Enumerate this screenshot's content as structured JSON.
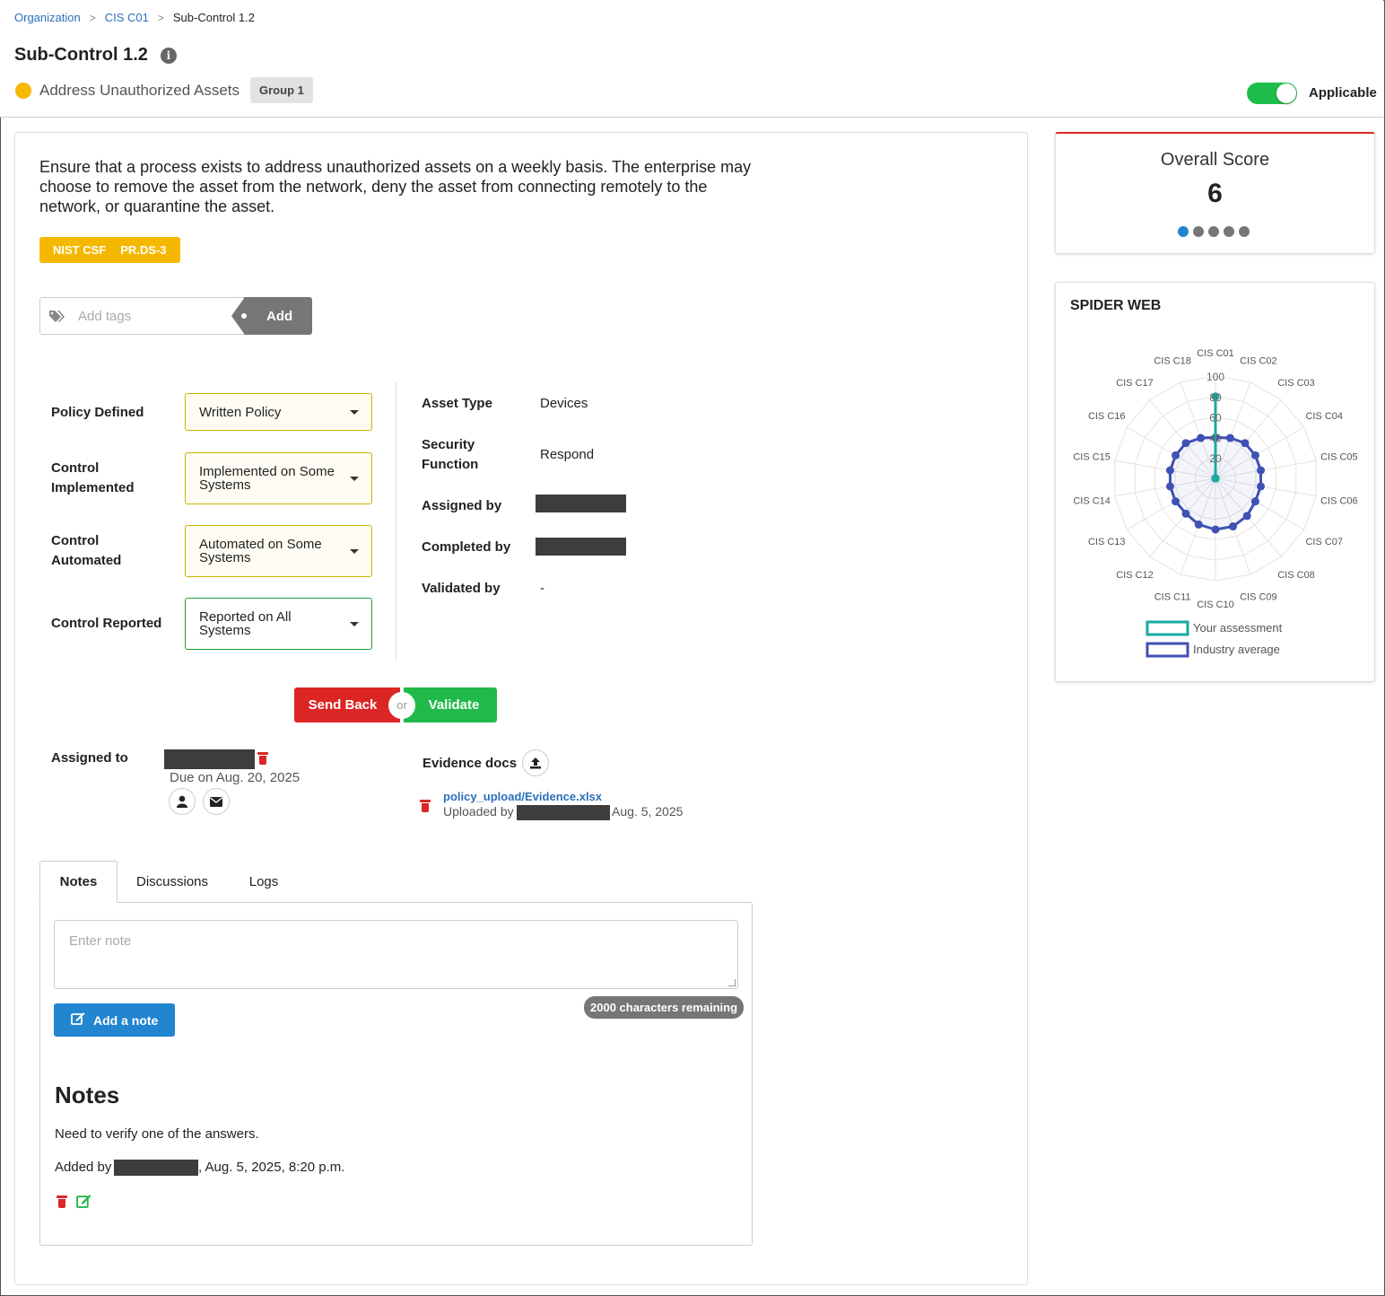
{
  "breadcrumb": [
    "Organization",
    "CIS C01",
    "Sub-Control 1.2"
  ],
  "page": {
    "title": "Sub-Control 1.2",
    "subtitle": "Address Unauthorized Assets",
    "group": "Group 1",
    "applicable_label": "Applicable",
    "applicable": true
  },
  "description": "Ensure that a process exists to address unauthorized assets on a weekly basis. The enterprise may choose to remove the asset from the network, deny the asset from connecting remotely to the network, or quarantine the asset.",
  "nist": {
    "framework": "NIST CSF",
    "code": "PR.DS-3"
  },
  "tags": {
    "placeholder": "Add tags",
    "add_label": "Add"
  },
  "fields": [
    {
      "label": "Policy Defined",
      "value": "Written Policy"
    },
    {
      "label": "Control Implemented",
      "value": "Implemented on Some Systems"
    },
    {
      "label": "Control Automated",
      "value": "Automated on Some Systems"
    },
    {
      "label": "Control Reported",
      "value": "Reported on All Systems"
    }
  ],
  "details": [
    {
      "label": "Asset Type",
      "value": "Devices"
    },
    {
      "label": "Security Function",
      "value": "Respond"
    },
    {
      "label": "Assigned by",
      "value": ""
    },
    {
      "label": "Completed by",
      "value": ""
    },
    {
      "label": "Validated by",
      "value": "-"
    }
  ],
  "actions": {
    "send_back": "Send Back",
    "or": "or",
    "validate": "Validate"
  },
  "assigned": {
    "label": "Assigned to",
    "due": "Due on Aug. 20, 2025"
  },
  "evidence": {
    "label": "Evidence docs",
    "file": "policy_upload/Evidence.xlsx",
    "uploaded_by": "Uploaded by",
    "date": "Aug. 5, 2025"
  },
  "tabs": [
    "Notes",
    "Discussions",
    "Logs"
  ],
  "notes_panel": {
    "placeholder": "Enter note",
    "add_label": "Add a note",
    "chars_remaining": "2000 characters remaining",
    "heading": "Notes",
    "items": [
      {
        "text": "Need to verify one of the answers.",
        "added_by": "Added by",
        "date": ", Aug. 5, 2025, 8:20 p.m."
      }
    ]
  },
  "score": {
    "title": "Overall Score",
    "value": "6",
    "dots": 5,
    "active_dot": 0
  },
  "spider": {
    "title": "SPIDER WEB"
  },
  "chart_data": {
    "type": "radar",
    "title": "SPIDER WEB",
    "categories": [
      "CIS C01",
      "CIS C02",
      "CIS C03",
      "CIS C04",
      "CIS C05",
      "CIS C06",
      "CIS C07",
      "CIS C08",
      "CIS C09",
      "CIS C10",
      "CIS C11",
      "CIS C12",
      "CIS C13",
      "CIS C14",
      "CIS C15",
      "CIS C16",
      "CIS C17",
      "CIS C18"
    ],
    "ticks": [
      20,
      40,
      60,
      80,
      100
    ],
    "rmax": 100,
    "series": [
      {
        "name": "Your assessment",
        "color": "#1aaaa0",
        "values": [
          80,
          0,
          0,
          0,
          0,
          0,
          0,
          0,
          0,
          0,
          0,
          0,
          0,
          0,
          0,
          0,
          0,
          0
        ]
      },
      {
        "name": "Industry average",
        "color": "#3f51b5",
        "values": [
          40,
          42,
          45,
          45,
          45,
          45,
          45,
          48,
          50,
          50,
          48,
          45,
          45,
          45,
          45,
          45,
          45,
          42
        ]
      }
    ],
    "legend_position": "bottom"
  },
  "colors": {
    "accent": "#2185d0",
    "danger": "#dc2626",
    "success": "#21b94a",
    "warning": "#f5b800"
  }
}
